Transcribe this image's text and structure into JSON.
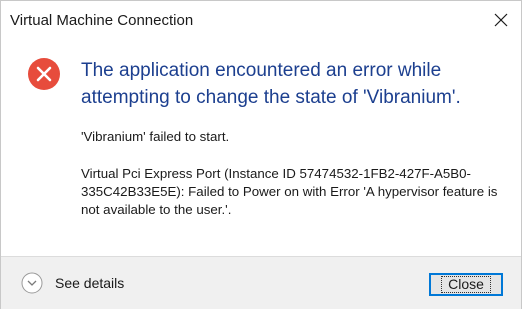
{
  "window": {
    "title": "Virtual Machine Connection"
  },
  "error": {
    "headline": "The application encountered an error while attempting to change the state of 'Vibranium'.",
    "message_1": "'Vibranium' failed to start.",
    "message_2": "Virtual Pci Express Port (Instance ID 57474532-1FB2-427F-A5B0-335C42B33E5E): Failed to Power on with Error 'A hypervisor feature is not available to the user.'."
  },
  "footer": {
    "see_details_label": "See details",
    "close_label": "Close"
  },
  "icons": {
    "error": "error-circle-x",
    "expand": "chevron-down-circle",
    "window_close": "x-mark"
  },
  "colors": {
    "error_red": "#e74c3c",
    "headline_blue": "#1c3f8f",
    "focus_blue": "#0078d7"
  }
}
